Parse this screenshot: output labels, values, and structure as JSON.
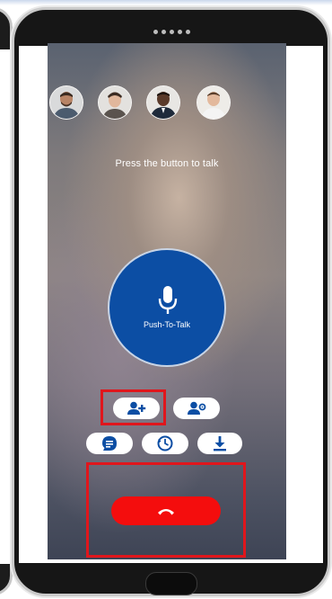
{
  "screen": {
    "prompt_text": "Press the button to talk",
    "push_to_talk_label": "Push-To-Talk"
  },
  "participants": [
    {
      "name": "participant-1",
      "icon": "avatar-photo"
    },
    {
      "name": "participant-2",
      "icon": "avatar-photo"
    },
    {
      "name": "participant-3",
      "icon": "avatar-photo"
    },
    {
      "name": "participant-4",
      "icon": "avatar-photo"
    }
  ],
  "actions": {
    "row1": [
      "add-participant-icon",
      "participant-settings-icon"
    ],
    "row2": [
      "chat-icon",
      "history-icon",
      "download-icon"
    ],
    "end_call_icon": "hang-up-icon"
  },
  "colors": {
    "ptt_blue": "#0c4ea4",
    "end_call_red": "#f40d0d",
    "highlight_red": "#e0161c",
    "icon_blue": "#0c4ea4"
  }
}
